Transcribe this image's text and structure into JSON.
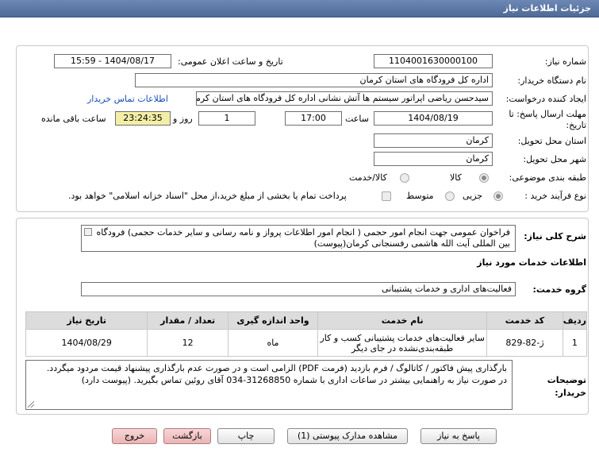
{
  "window": {
    "title": "جزئیات اطلاعات نیاز"
  },
  "form": {
    "need_number_label": "شماره نیاز:",
    "need_number": "1104001630000100",
    "announce_label": "تاریخ و ساعت اعلان عمومی:",
    "announce_value": "1404/08/17 - 15:59",
    "buyer_org_label": "نام دستگاه خریدار:",
    "buyer_org": "اداره کل فرودگاه های استان کرمان",
    "creator_label": "ایجاد کننده درخواست:",
    "creator": "سیدحسن ریاضی اپراتور سیستم ها آتش نشانی اداره کل فرودگاه های استان کرمان",
    "contact_link": "اطلاعات تماس خریدار",
    "deadline_label_1": "مهلت ارسال پاسخ: تا",
    "deadline_label_2": "تاریخ:",
    "deadline_date": "1404/08/19",
    "time_label": "ساعت",
    "deadline_time": "17:00",
    "days_value": "1",
    "days_label": "روز و",
    "remaining_time": "23:24:35",
    "remaining_label": "ساعت باقی مانده",
    "province_label": "استان محل تحویل:",
    "province": "کرمان",
    "city_label": "شهر محل تحویل:",
    "city": "کرمان",
    "category_label": "طبقه بندی موضوعی:",
    "category_options": [
      "کالا",
      "کالا/خدمت"
    ],
    "process_label": "نوع فرآیند خرید :",
    "process_options": [
      "جزیی",
      "متوسط"
    ],
    "payment_note": "پرداخت تمام یا بخشی از مبلغ خرید،از محل \"اسناد خزانه اسلامی\" خواهد بود."
  },
  "need": {
    "summary_label": "شرح کلی نیاز:",
    "summary_text": "فراخوان عمومی جهت انجام امور حجمی ( انجام امور اطلاعات پرواز و نامه رسانی و سایر خدمات حجمی) فرودگاه بین المللی آیت الله هاشمی رفسنجانی کرمان(پیوست)",
    "services_title": "اطلاعات خدمات مورد نیاز",
    "service_group_label": "گروه خدمت:",
    "service_group": "فعالیت‌های اداری و خدمات پشتیبانی"
  },
  "table": {
    "headers": [
      "ردیف",
      "کد خدمت",
      "نام خدمت",
      "واحد اندازه گیری",
      "تعداد / مقدار",
      "تاریخ نیاز"
    ],
    "rows": [
      {
        "row": "1",
        "code": "ژ-82-829",
        "name_line1": "سایر فعالیت‌های خدمات پشتیبانی کسب و کار",
        "name_line2": "طبقه‌بندی‌نشده در جای دیگر",
        "unit": "ماه",
        "qty": "12",
        "date": "1404/08/29"
      }
    ]
  },
  "notes": {
    "label_1": "توضیحات",
    "label_2": "خریدار:",
    "line1": "بارگذاری پیش فاکتور / کاتالوگ / فرم بازدید (فرمت PDF) الزامی است و در صورت عدم بارگذاری پیشنهاد قیمت مردود میگردد.",
    "line2": "در صورت نیاز به راهنمایی بیشتر در ساعات اداری با شماره 31268850-034 آقای روئین تماس بگیرید. (پیوست دارد)"
  },
  "buttons": {
    "reply": "پاسخ به نیاز",
    "attachments": "مشاهده مدارک پیوستی (1)",
    "print": "چاپ",
    "back": "بازگشت",
    "exit": "خروج"
  }
}
